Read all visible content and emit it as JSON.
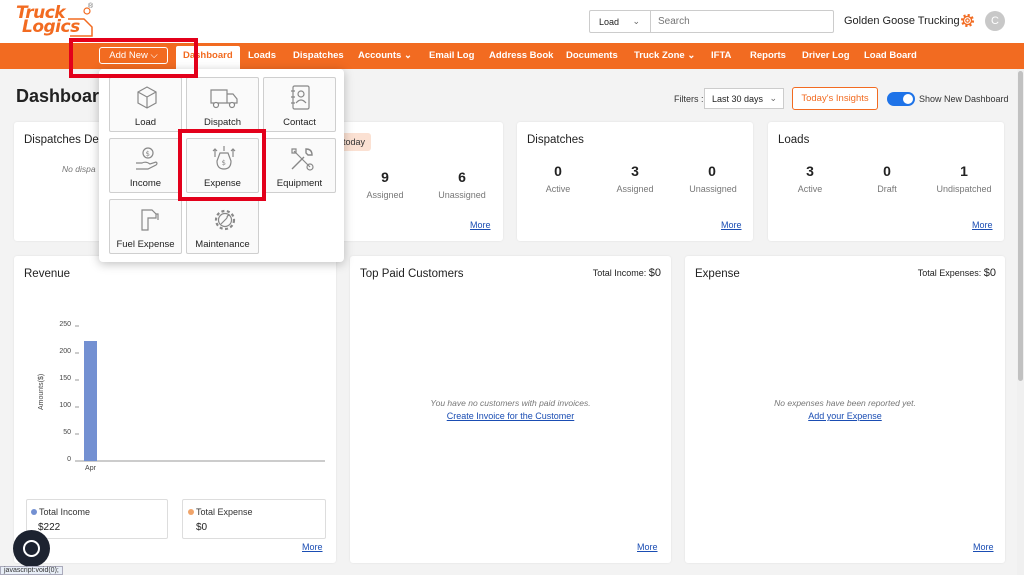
{
  "header": {
    "logo_line1": "Truck",
    "logo_line2": "Logics",
    "logo_mark": "®",
    "search_type": "Load",
    "search_placeholder": "Search",
    "company": "Golden Goose Trucking",
    "avatar_initial": "C"
  },
  "nav": {
    "add_new": "Add New",
    "items": [
      "Dashboard",
      "Loads",
      "Dispatches",
      "Accounts",
      "Email Log",
      "Address Book",
      "Documents",
      "Truck Zone",
      "IFTA",
      "Reports",
      "Driver Log",
      "Load Board"
    ],
    "active": "Dashboard"
  },
  "add_menu": {
    "tiles": [
      "Load",
      "Dispatch",
      "Contact",
      "Income",
      "Expense",
      "Equipment",
      "Fuel Expense",
      "Maintenance"
    ],
    "highlighted": "Expense"
  },
  "page": {
    "title": "Dashboard",
    "filters_label": "Filters :",
    "filter_value": "Last 30 days",
    "insights_button": "Today's Insights",
    "toggle_label": "Show New Dashboard",
    "toggle_on": true
  },
  "cards": {
    "dispatches_due": {
      "title": "Dispatches De",
      "message": "No dispa",
      "today_badge": "today",
      "stats": [
        {
          "value": "9",
          "label": "Assigned"
        },
        {
          "value": "6",
          "label": "Unassigned"
        }
      ],
      "more": "More"
    },
    "dispatches": {
      "title": "Dispatches",
      "stats": [
        {
          "value": "0",
          "label": "Active"
        },
        {
          "value": "3",
          "label": "Assigned"
        },
        {
          "value": "0",
          "label": "Unassigned"
        }
      ],
      "more": "More"
    },
    "loads": {
      "title": "Loads",
      "stats": [
        {
          "value": "3",
          "label": "Active"
        },
        {
          "value": "0",
          "label": "Draft"
        },
        {
          "value": "1",
          "label": "Undispatched"
        }
      ],
      "more": "More"
    },
    "revenue": {
      "title": "Revenue",
      "legend": [
        {
          "name": "Total Income",
          "value": "$222",
          "color": "#7390d2"
        },
        {
          "name": "Total Expense",
          "value": "$0",
          "color": "#f0a46a"
        }
      ],
      "more": "More"
    },
    "top_paid": {
      "title": "Top Paid Customers",
      "total_label": "Total Income:",
      "total_value": "$0",
      "message": "You have no customers with paid invoices.",
      "link": "Create Invoice for the Customer",
      "more": "More"
    },
    "expense": {
      "title": "Expense",
      "total_label": "Total Expenses:",
      "total_value": "$0",
      "message": "No expenses have been reported yet.",
      "link": "Add your Expense",
      "more": "More"
    }
  },
  "chart_data": {
    "type": "bar",
    "categories": [
      "Apr"
    ],
    "series": [
      {
        "name": "Total Income",
        "values": [
          222
        ]
      }
    ],
    "ylabel": "Amounts($)",
    "yticks": [
      0,
      50,
      100,
      150,
      200,
      250
    ],
    "ylim": [
      0,
      250
    ]
  },
  "status_bar": "javascript:void(0);",
  "colors": {
    "brand": "#f26b21",
    "highlight": "#e3001b",
    "link": "#1a4db3"
  }
}
